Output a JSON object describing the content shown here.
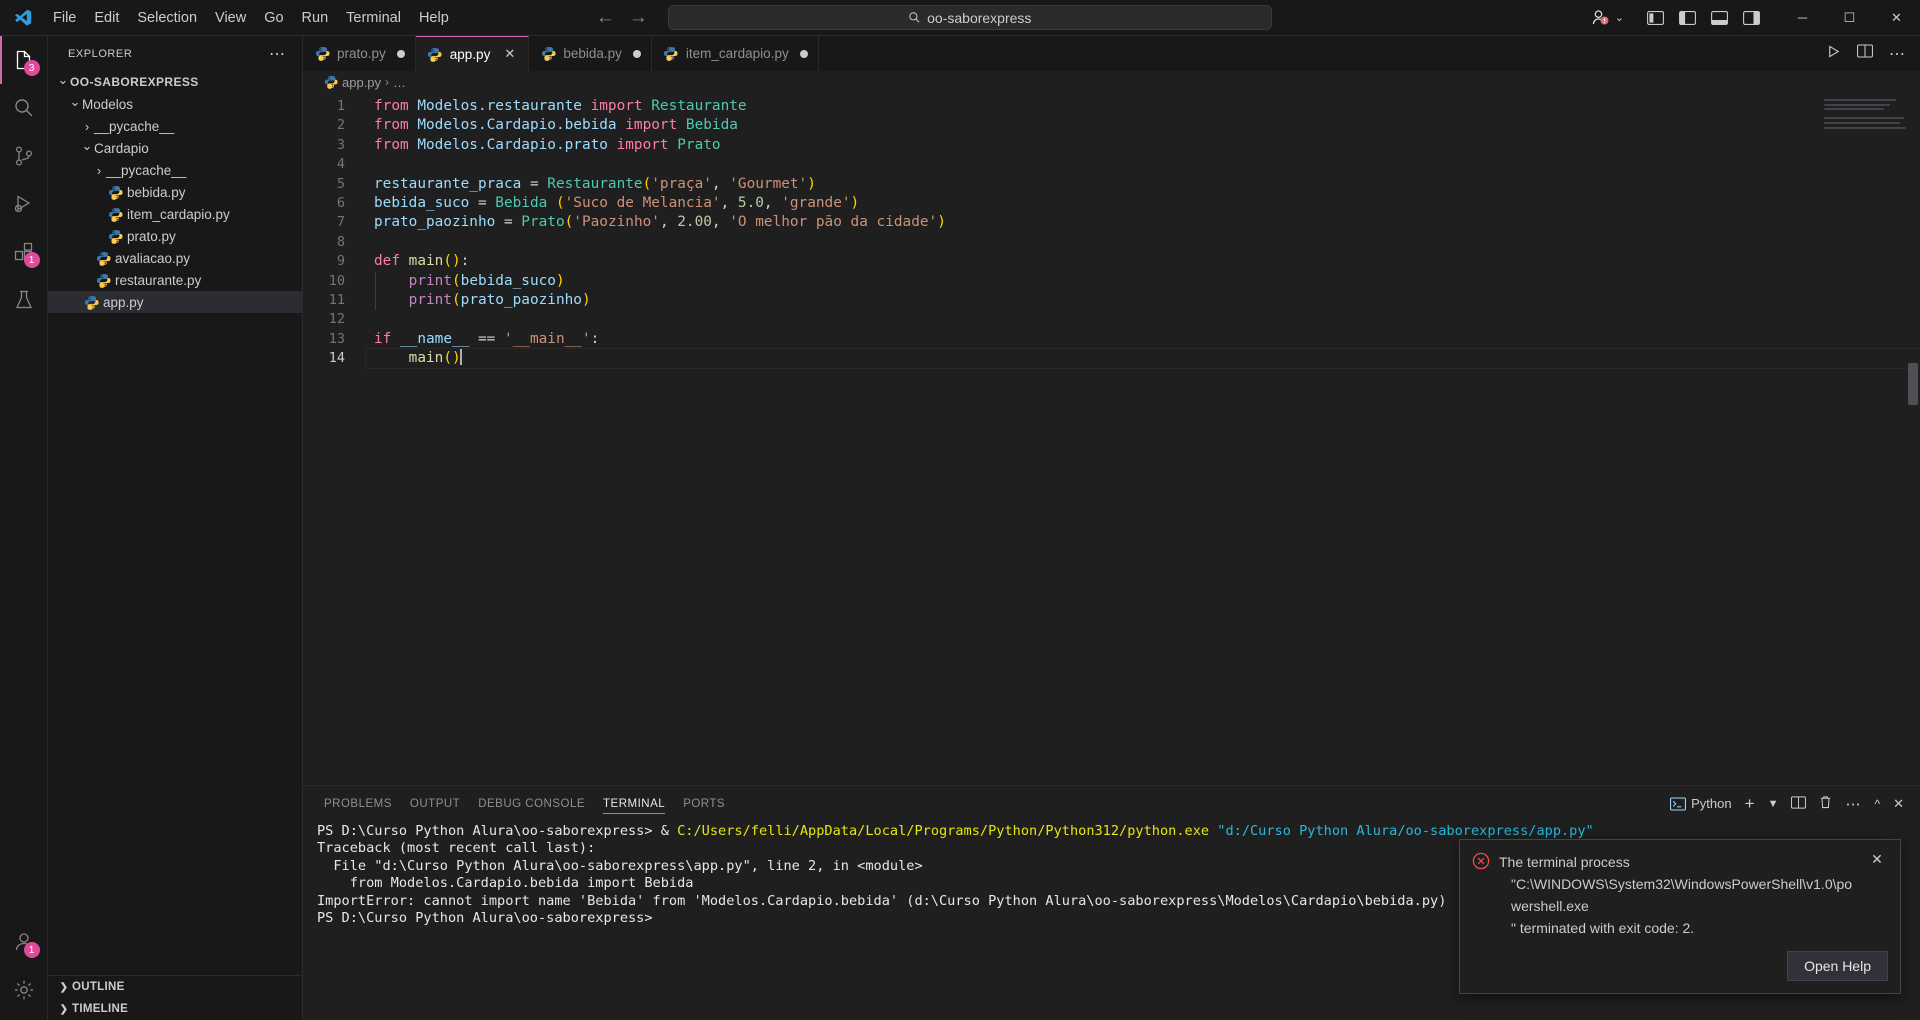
{
  "titlebar": {
    "logo_icon": "vscode-logo-icon",
    "menus": [
      "File",
      "Edit",
      "Selection",
      "View",
      "Go",
      "Run",
      "Terminal",
      "Help"
    ],
    "back_icon": "arrow-left-icon",
    "forward_icon": "arrow-right-icon",
    "command_center": {
      "icon": "search-icon",
      "value": "oo-saborexpress"
    },
    "remote_icon": "remote-account-icon",
    "chevron": "⌄",
    "layout_icons": [
      "layout-panel-left-icon",
      "layout-sidebar-left-icon",
      "layout-panel-bottom-icon",
      "layout-sidebar-right-icon"
    ],
    "window_controls": {
      "minimize": "─",
      "maximize": "☐",
      "close": "✕"
    }
  },
  "activitybar": {
    "items": [
      {
        "name": "explorer",
        "icon": "files-icon",
        "badge": "3",
        "active": true
      },
      {
        "name": "search",
        "icon": "search-icon",
        "badge": "",
        "active": false
      },
      {
        "name": "source-control",
        "icon": "source-control-icon",
        "badge": "",
        "active": false
      },
      {
        "name": "run-and-debug",
        "icon": "run-debug-icon",
        "badge": "",
        "active": false
      },
      {
        "name": "extensions",
        "icon": "extensions-icon",
        "badge": "1",
        "active": false
      },
      {
        "name": "testing",
        "icon": "beaker-icon",
        "badge": "",
        "active": false
      }
    ],
    "bottom": [
      {
        "name": "accounts",
        "icon": "account-icon",
        "badge": "1"
      },
      {
        "name": "settings",
        "icon": "gear-icon",
        "badge": ""
      }
    ]
  },
  "sidebar": {
    "title": "EXPLORER",
    "more_icon": "more-actions-icon",
    "tree": [
      {
        "label": "OO-SABOREXPRESS",
        "depth": 0,
        "type": "root",
        "expanded": true,
        "selected": false
      },
      {
        "label": "Modelos",
        "depth": 1,
        "type": "folder",
        "expanded": true,
        "selected": false
      },
      {
        "label": "__pycache__",
        "depth": 2,
        "type": "folder",
        "expanded": false,
        "selected": false
      },
      {
        "label": "Cardapio",
        "depth": 2,
        "type": "folder",
        "expanded": true,
        "selected": false
      },
      {
        "label": "__pycache__",
        "depth": 3,
        "type": "folder",
        "expanded": false,
        "selected": false
      },
      {
        "label": "bebida.py",
        "depth": 3,
        "type": "python",
        "expanded": false,
        "selected": false
      },
      {
        "label": "item_cardapio.py",
        "depth": 3,
        "type": "python",
        "expanded": false,
        "selected": false
      },
      {
        "label": "prato.py",
        "depth": 3,
        "type": "python",
        "expanded": false,
        "selected": false
      },
      {
        "label": "avaliacao.py",
        "depth": 2,
        "type": "python",
        "expanded": false,
        "selected": false
      },
      {
        "label": "restaurante.py",
        "depth": 2,
        "type": "python",
        "expanded": false,
        "selected": false
      },
      {
        "label": "app.py",
        "depth": 1,
        "type": "python",
        "expanded": false,
        "selected": true
      }
    ],
    "sections": [
      {
        "label": "OUTLINE",
        "expanded": false
      },
      {
        "label": "TIMELINE",
        "expanded": false
      }
    ]
  },
  "tabs": {
    "items": [
      {
        "label": "prato.py",
        "active": false,
        "dirty": true,
        "closable": false
      },
      {
        "label": "app.py",
        "active": true,
        "dirty": false,
        "closable": true
      },
      {
        "label": "bebida.py",
        "active": false,
        "dirty": true,
        "closable": false
      },
      {
        "label": "item_cardapio.py",
        "active": false,
        "dirty": true,
        "closable": false
      }
    ],
    "actions": [
      "run-play-icon",
      "split-editor-icon",
      "more-actions-icon"
    ]
  },
  "breadcrumbs": {
    "file": "app.py",
    "separator": "›",
    "tail": "…"
  },
  "editor": {
    "cursor_line": 14,
    "lines": [
      {
        "n": 1,
        "tokens": [
          {
            "t": "from ",
            "c": "kw"
          },
          {
            "t": "Modelos.restaurante ",
            "c": "mod"
          },
          {
            "t": "import ",
            "c": "kw"
          },
          {
            "t": "Restaurante",
            "c": "cls"
          }
        ]
      },
      {
        "n": 2,
        "tokens": [
          {
            "t": "from ",
            "c": "kw"
          },
          {
            "t": "Modelos.Cardapio.bebida ",
            "c": "mod"
          },
          {
            "t": "import ",
            "c": "kw"
          },
          {
            "t": "Bebida",
            "c": "cls"
          }
        ]
      },
      {
        "n": 3,
        "tokens": [
          {
            "t": "from ",
            "c": "kw"
          },
          {
            "t": "Modelos.Cardapio.prato ",
            "c": "mod"
          },
          {
            "t": "import ",
            "c": "kw"
          },
          {
            "t": "Prato",
            "c": "cls"
          }
        ]
      },
      {
        "n": 4,
        "tokens": []
      },
      {
        "n": 5,
        "tokens": [
          {
            "t": "restaurante_praca ",
            "c": "var"
          },
          {
            "t": "= ",
            "c": "op"
          },
          {
            "t": "Restaurante",
            "c": "cls"
          },
          {
            "t": "(",
            "c": "pun"
          },
          {
            "t": "'praça'",
            "c": "str"
          },
          {
            "t": ", ",
            "c": "op"
          },
          {
            "t": "'Gourmet'",
            "c": "str"
          },
          {
            "t": ")",
            "c": "pun"
          }
        ]
      },
      {
        "n": 6,
        "tokens": [
          {
            "t": "bebida_suco ",
            "c": "var"
          },
          {
            "t": "= ",
            "c": "op"
          },
          {
            "t": "Bebida ",
            "c": "cls"
          },
          {
            "t": "(",
            "c": "pun"
          },
          {
            "t": "'Suco de Melancia'",
            "c": "str"
          },
          {
            "t": ", ",
            "c": "op"
          },
          {
            "t": "5.0",
            "c": "num"
          },
          {
            "t": ", ",
            "c": "op"
          },
          {
            "t": "'grande'",
            "c": "str"
          },
          {
            "t": ")",
            "c": "pun"
          }
        ]
      },
      {
        "n": 7,
        "tokens": [
          {
            "t": "prato_paozinho ",
            "c": "var"
          },
          {
            "t": "= ",
            "c": "op"
          },
          {
            "t": "Prato",
            "c": "cls"
          },
          {
            "t": "(",
            "c": "pun"
          },
          {
            "t": "'Paozinho'",
            "c": "str"
          },
          {
            "t": ", ",
            "c": "op"
          },
          {
            "t": "2.00",
            "c": "num"
          },
          {
            "t": ", ",
            "c": "op"
          },
          {
            "t": "'O melhor pão da cidade'",
            "c": "str"
          },
          {
            "t": ")",
            "c": "pun"
          }
        ]
      },
      {
        "n": 8,
        "tokens": []
      },
      {
        "n": 9,
        "tokens": [
          {
            "t": "def ",
            "c": "kw"
          },
          {
            "t": "main",
            "c": "fn"
          },
          {
            "t": "()",
            "c": "pun"
          },
          {
            "t": ":",
            "c": "op"
          }
        ]
      },
      {
        "n": 10,
        "tokens": [
          {
            "t": "    ",
            "c": "op"
          },
          {
            "t": "print",
            "c": "bi"
          },
          {
            "t": "(",
            "c": "pun"
          },
          {
            "t": "bebida_suco",
            "c": "var"
          },
          {
            "t": ")",
            "c": "pun"
          }
        ]
      },
      {
        "n": 11,
        "tokens": [
          {
            "t": "    ",
            "c": "op"
          },
          {
            "t": "print",
            "c": "bi"
          },
          {
            "t": "(",
            "c": "pun"
          },
          {
            "t": "prato_paozinho",
            "c": "var"
          },
          {
            "t": ")",
            "c": "pun"
          }
        ]
      },
      {
        "n": 12,
        "tokens": []
      },
      {
        "n": 13,
        "tokens": [
          {
            "t": "if ",
            "c": "kw"
          },
          {
            "t": "__name__ ",
            "c": "dunder"
          },
          {
            "t": "== ",
            "c": "op"
          },
          {
            "t": "'__main__'",
            "c": "str"
          },
          {
            "t": ":",
            "c": "op"
          }
        ]
      },
      {
        "n": 14,
        "tokens": [
          {
            "t": "    ",
            "c": "op"
          },
          {
            "t": "main",
            "c": "fn"
          },
          {
            "t": "()",
            "c": "pun"
          }
        ]
      }
    ]
  },
  "panel": {
    "tabs": [
      {
        "label": "PROBLEMS",
        "active": false
      },
      {
        "label": "OUTPUT",
        "active": false
      },
      {
        "label": "DEBUG CONSOLE",
        "active": false
      },
      {
        "label": "TERMINAL",
        "active": true
      },
      {
        "label": "PORTS",
        "active": false
      }
    ],
    "terminal_name": "Python",
    "terminal_icon": "terminal-icon",
    "actions": [
      "new-terminal-icon",
      "chevron-down-icon",
      "split-terminal-icon",
      "kill-terminal-icon",
      "more-actions-icon",
      "chevron-up-icon",
      "close-icon"
    ],
    "terminal_lines": [
      [
        {
          "t": "PS D:\\Curso Python Alura\\oo-saborexpress> ",
          "c": "t-white"
        },
        {
          "t": "& ",
          "c": "t-white"
        },
        {
          "t": "C:/Users/felli/AppData/Local/Programs/Python/Python312/python.exe ",
          "c": "t-yellow"
        },
        {
          "t": "\"d:/Curso Python Alura/oo-saborexpress/app.py\"",
          "c": "t-cyan"
        }
      ],
      [
        {
          "t": "Traceback (most recent call last):",
          "c": "t-white"
        }
      ],
      [
        {
          "t": "  File \"d:\\Curso Python Alura\\oo-saborexpress\\app.py\", line 2, in <module>",
          "c": "t-white"
        }
      ],
      [
        {
          "t": "    from Modelos.Cardapio.bebida import Bebida",
          "c": "t-white"
        }
      ],
      [
        {
          "t": "ImportError: cannot import name 'Bebida' from 'Modelos.Cardapio.bebida' (d:\\Curso Python Alura\\oo-saborexpress\\Modelos\\Cardapio\\bebida.py)",
          "c": "t-white"
        }
      ],
      [
        {
          "t": "PS D:\\Curso Python Alura\\oo-saborexpress>",
          "c": "t-white"
        }
      ]
    ]
  },
  "notification": {
    "error_icon": "error-circle-icon",
    "close_icon": "close-icon",
    "line1": "The terminal process",
    "line2": "\"C:\\WINDOWS\\System32\\WindowsPowerShell\\v1.0\\powershell.exe",
    "line3": "\" terminated with exit code: 2.",
    "button": "Open Help"
  },
  "colors": {
    "accent": "#cf6ab1",
    "badge": "#e14a9b",
    "error": "#f14c4c",
    "bg": "#1f1f1f",
    "chrome": "#181818"
  }
}
